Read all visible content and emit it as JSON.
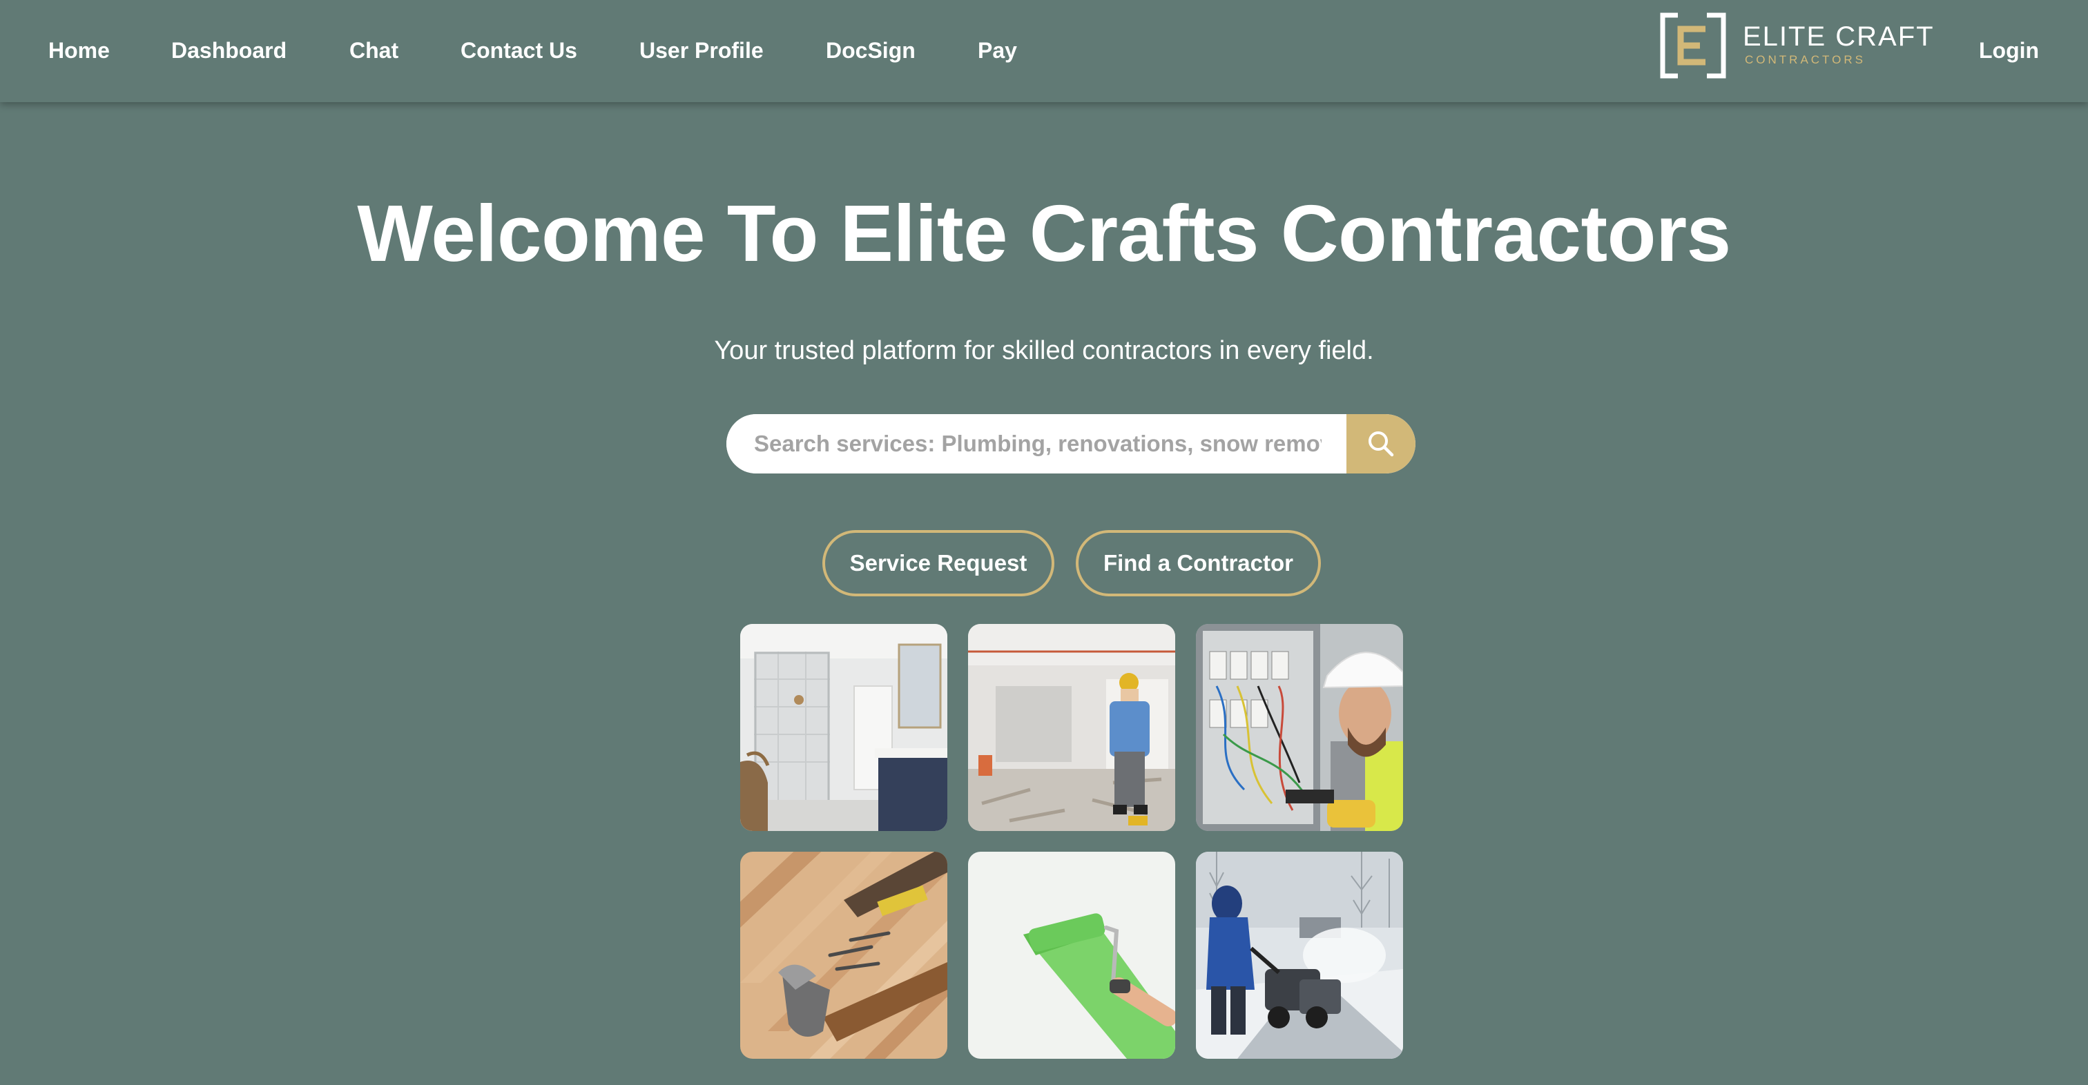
{
  "nav": {
    "items": [
      {
        "label": "Home"
      },
      {
        "label": "Dashboard"
      },
      {
        "label": "Chat"
      },
      {
        "label": "Contact Us"
      },
      {
        "label": "User Profile"
      },
      {
        "label": "DocSign"
      },
      {
        "label": "Pay"
      }
    ],
    "login_label": "Login"
  },
  "logo": {
    "name": "ELITE CRAFT",
    "tagline": "CONTRACTORS",
    "icon": "elite-craft-logo-mark"
  },
  "hero": {
    "title": "Welcome To Elite Crafts Contractors",
    "subtitle": "Your trusted platform for skilled contractors in every field."
  },
  "search": {
    "placeholder": "Search services: Plumbing, renovations, snow removal...",
    "value": "",
    "icon": "search-icon"
  },
  "actions": {
    "service_request": "Service Request",
    "find_contractor": "Find a Contractor"
  },
  "services": [
    {
      "icon": "bathroom-photo"
    },
    {
      "icon": "renovation-photo"
    },
    {
      "icon": "electrician-photo"
    },
    {
      "icon": "carpentry-photo"
    },
    {
      "icon": "painting-photo"
    },
    {
      "icon": "snow-removal-photo"
    }
  ],
  "colors": {
    "background": "#617a75",
    "accent": "#d2b878",
    "text": "#ffffff"
  }
}
